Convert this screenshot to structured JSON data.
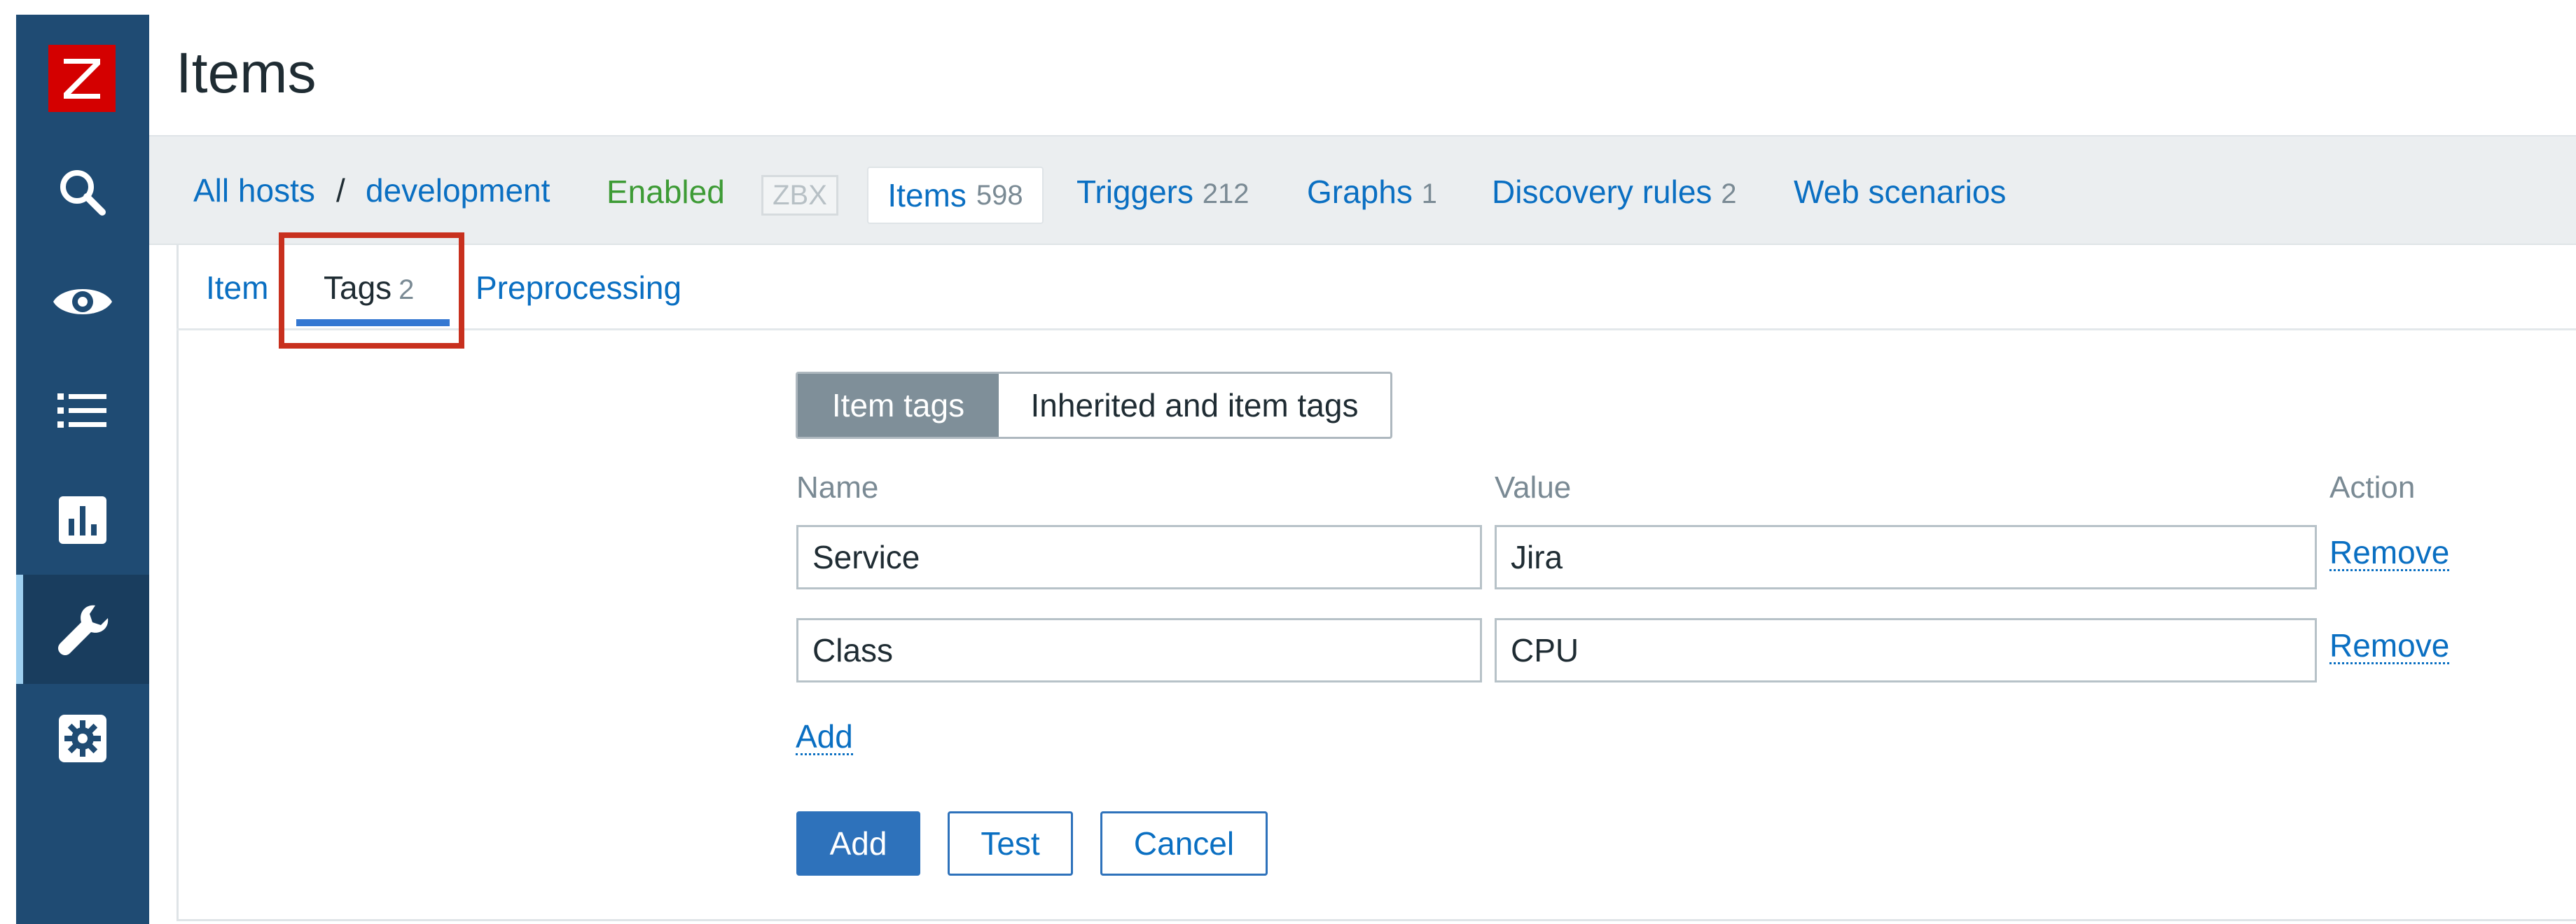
{
  "page": {
    "title": "Items"
  },
  "sidebar": {
    "items": [
      {
        "icon": "search-icon"
      },
      {
        "icon": "eye-icon"
      },
      {
        "icon": "list-icon"
      },
      {
        "icon": "chart-icon"
      },
      {
        "icon": "wrench-icon",
        "active": true
      },
      {
        "icon": "gear-icon"
      }
    ]
  },
  "breadcrumb": {
    "all_hosts": "All hosts",
    "separator": "/",
    "host": "development",
    "status": "Enabled",
    "availability": "ZBX"
  },
  "host_nav": {
    "items_label": "Items",
    "items_count": "598",
    "triggers_label": "Triggers",
    "triggers_count": "212",
    "graphs_label": "Graphs",
    "graphs_count": "1",
    "discovery_label": "Discovery rules",
    "discovery_count": "2",
    "web_label": "Web scenarios"
  },
  "form_tabs": {
    "item": "Item",
    "tags": "Tags",
    "tags_count": "2",
    "preprocessing": "Preprocessing"
  },
  "tag_mode": {
    "item_tags": "Item tags",
    "inherited": "Inherited and item tags"
  },
  "tags_table": {
    "headers": {
      "name": "Name",
      "value": "Value",
      "action": "Action"
    },
    "rows": [
      {
        "name": "Service",
        "value": "Jira",
        "action": "Remove"
      },
      {
        "name": "Class",
        "value": "CPU",
        "action": "Remove"
      }
    ],
    "add_link": "Add"
  },
  "buttons": {
    "add": "Add",
    "test": "Test",
    "cancel": "Cancel"
  },
  "colors": {
    "sidebar": "#1f4b73",
    "link": "#0a6fc2",
    "enabled": "#3d9b35",
    "highlight": "#c8301e",
    "primary_button": "#2e72bb"
  }
}
